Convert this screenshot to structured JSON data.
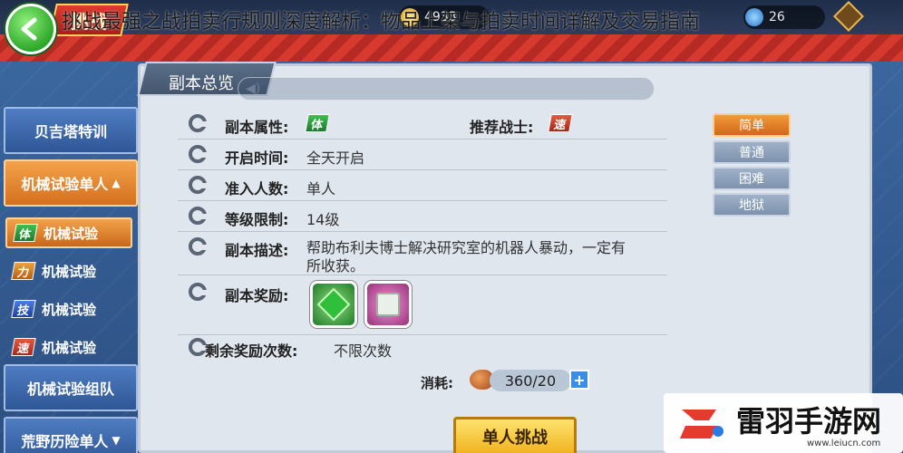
{
  "headline": "挑战最强之战拍卖行规则深度解析：物品上架与拍卖时间详解及交易指南",
  "header": {
    "mode_label": "挑战",
    "gold_value": "4933",
    "energy_value": "26"
  },
  "panel": {
    "title": "副本总览"
  },
  "info": {
    "attr_label": "副本属性:",
    "attr_value": "体",
    "recommended_label": "推荐战士:",
    "recommended_value": "速",
    "open_time_label": "开启时间:",
    "open_time_value": "全天开启",
    "players_label": "准入人数:",
    "players_value": "单人",
    "level_label": "等级限制:",
    "level_value": "14级",
    "desc_label": "副本描述:",
    "desc_line1": "帮助布利夫博士解决研究室的机器人暴动，一定有",
    "desc_line2": "所收获。",
    "rewards_label": "副本奖励:",
    "remaining_label": "剩余奖励次数:",
    "remaining_value": "不限次数"
  },
  "cost": {
    "label": "消耗:",
    "value": "360/20",
    "plus": "+"
  },
  "solo_button": "单人挑战",
  "difficulty": [
    "简单",
    "普通",
    "困难",
    "地狱"
  ],
  "menu": {
    "beiji": "贝吉塔特训",
    "mech_solo": "机械试验单人",
    "mech_team": "机械试验组队",
    "wild_solo": "荒野历险单人",
    "subs": [
      {
        "elem": "体",
        "label": "机械试验"
      },
      {
        "elem": "力",
        "label": "机械试验"
      },
      {
        "elem": "技",
        "label": "机械试验"
      },
      {
        "elem": "速",
        "label": "机械试验"
      }
    ]
  },
  "watermark": {
    "text": "雷羽手游网",
    "url": "www.leiucn.com"
  },
  "colors": {
    "accent_orange": "#f3a24a",
    "panel_bg": "#dfe6ee",
    "menu_blue": "#4f7cc2"
  }
}
